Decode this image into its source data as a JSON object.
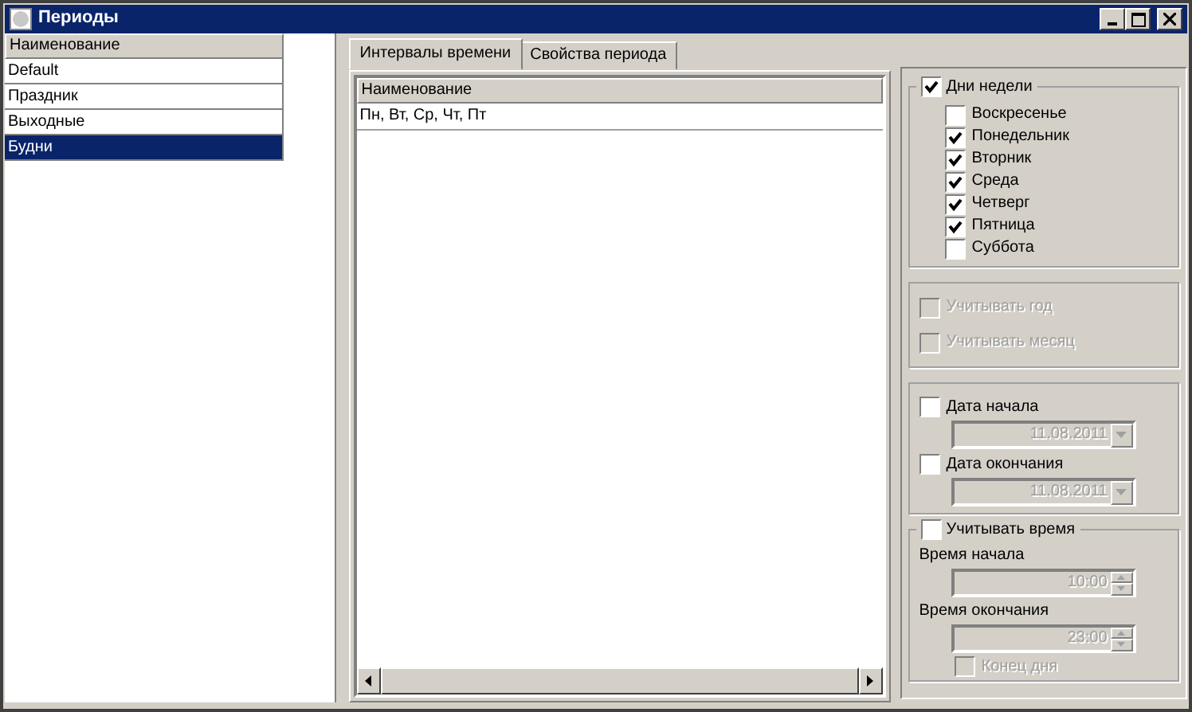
{
  "window": {
    "title": "Периоды"
  },
  "periods": {
    "column": "Наименование",
    "rows": [
      {
        "name": "Default",
        "selected": false
      },
      {
        "name": "Праздник",
        "selected": false
      },
      {
        "name": "Выходные",
        "selected": false
      },
      {
        "name": "Будни",
        "selected": true
      }
    ]
  },
  "tabs": [
    {
      "label": "Интервалы времени",
      "selected": true
    },
    {
      "label": "Свойства периода",
      "selected": false
    }
  ],
  "intervals": {
    "column": "Наименование",
    "rows": [
      {
        "name": "Пн, Вт, Ср, Чт, Пт"
      }
    ]
  },
  "weekdays": {
    "label": "Дни недели",
    "checked": true,
    "days": [
      {
        "label": "Воскресенье",
        "checked": false
      },
      {
        "label": "Понедельник",
        "checked": true
      },
      {
        "label": "Вторник",
        "checked": true
      },
      {
        "label": "Среда",
        "checked": true
      },
      {
        "label": "Четверг",
        "checked": true
      },
      {
        "label": "Пятница",
        "checked": true
      },
      {
        "label": "Суббота",
        "checked": false
      }
    ]
  },
  "consider": [
    {
      "label": "Учитывать год",
      "checked": false,
      "disabled": true
    },
    {
      "label": "Учитывать месяц",
      "checked": false,
      "disabled": true
    }
  ],
  "dates": [
    {
      "label": "Дата начала",
      "checked": false,
      "field": {
        "value": "11.08.2011",
        "disabled": true
      }
    },
    {
      "label": "Дата окончания",
      "checked": false,
      "field": {
        "value": "11.08.2011",
        "disabled": true
      }
    }
  ],
  "time": {
    "label": "Учитывать время",
    "checked": false,
    "fields": [
      {
        "label": "Время начала",
        "value": "10:00",
        "disabled": true
      },
      {
        "label": "Время окончания",
        "value": "23:00",
        "disabled": true
      }
    ],
    "end_of_day": {
      "label": "Конец дня",
      "checked": false,
      "disabled": true
    }
  }
}
